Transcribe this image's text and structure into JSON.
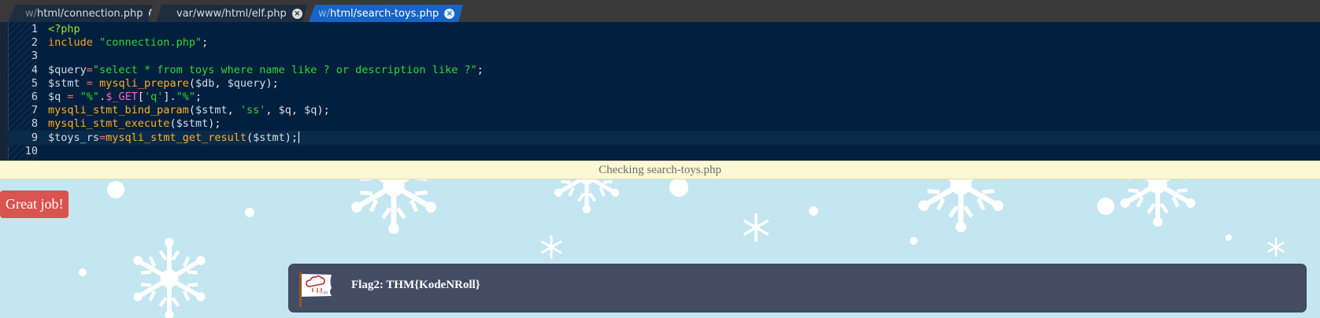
{
  "editor": {
    "tabs": [
      {
        "dim": "w/",
        "path": "html/connection.php",
        "active": false,
        "close": "×"
      },
      {
        "dim": "",
        "path": "var/www/html/elf.php",
        "active": false,
        "close": "×"
      },
      {
        "dim": "w/",
        "path": "html/search-toys.php",
        "active": true,
        "close": "×"
      }
    ],
    "code_lines": [
      {
        "n": "1",
        "tokens": [
          [
            "tag",
            "<?php"
          ]
        ]
      },
      {
        "n": "2",
        "tokens": [
          [
            "kw",
            "include "
          ],
          [
            "str",
            "\"connection.php\""
          ],
          [
            "pl",
            ";"
          ]
        ]
      },
      {
        "n": "3",
        "tokens": []
      },
      {
        "n": "4",
        "tokens": [
          [
            "var",
            "$query"
          ],
          [
            "op",
            "="
          ],
          [
            "str",
            "\"select * from toys where name like ? or description like ?\""
          ],
          [
            "pl",
            ";"
          ]
        ]
      },
      {
        "n": "5",
        "tokens": [
          [
            "var",
            "$stmt "
          ],
          [
            "op",
            "="
          ],
          [
            "pl",
            " "
          ],
          [
            "fn",
            "mysqli_prepare"
          ],
          [
            "pl",
            "("
          ],
          [
            "var",
            "$db"
          ],
          [
            "pl",
            ", "
          ],
          [
            "var",
            "$query"
          ],
          [
            "pl",
            ");"
          ]
        ]
      },
      {
        "n": "6",
        "tokens": [
          [
            "var",
            "$q "
          ],
          [
            "op",
            "="
          ],
          [
            "pl",
            " "
          ],
          [
            "str",
            "\"%\""
          ],
          [
            "pl",
            "."
          ],
          [
            "sg",
            "$_GET"
          ],
          [
            "pl",
            "["
          ],
          [
            "str",
            "'q'"
          ],
          [
            "pl",
            "]."
          ],
          [
            "str",
            "\"%\""
          ],
          [
            "pl",
            ";"
          ]
        ]
      },
      {
        "n": "7",
        "tokens": [
          [
            "fn",
            "mysqli_stmt_bind_param"
          ],
          [
            "pl",
            "("
          ],
          [
            "var",
            "$stmt"
          ],
          [
            "pl",
            ", "
          ],
          [
            "str",
            "'ss'"
          ],
          [
            "pl",
            ", "
          ],
          [
            "var",
            "$q"
          ],
          [
            "pl",
            ", "
          ],
          [
            "var",
            "$q"
          ],
          [
            "pl",
            ");"
          ]
        ]
      },
      {
        "n": "8",
        "tokens": [
          [
            "fn",
            "mysqli_stmt_execute"
          ],
          [
            "pl",
            "("
          ],
          [
            "var",
            "$stmt"
          ],
          [
            "pl",
            ");"
          ]
        ]
      },
      {
        "n": "9",
        "tokens": [
          [
            "var",
            "$toys_rs"
          ],
          [
            "op",
            "="
          ],
          [
            "fn",
            "mysqli_stmt_get_result"
          ],
          [
            "pl",
            "("
          ],
          [
            "var",
            "$stmt"
          ],
          [
            "pl",
            ");"
          ]
        ],
        "current": true
      },
      {
        "n": "10",
        "tokens": []
      }
    ]
  },
  "page": {
    "status_text": "Checking search-toys.php",
    "great_job_label": "Great job!",
    "flag_text": "Flag2: THM{KodeNRoll}",
    "icons": {
      "flag": "flag-icon"
    }
  },
  "colors": {
    "editor_bg": "#011f3e",
    "active_tab": "#1664c4",
    "page_bg": "#c3e6f1",
    "great_job_bg": "#d9534f",
    "flag_card_bg": "#434c63"
  }
}
